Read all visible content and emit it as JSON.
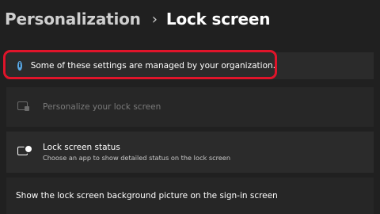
{
  "breadcrumb": {
    "parent": "Personalization",
    "separator": "›",
    "current": "Lock screen"
  },
  "info_bar": {
    "icon": "info-icon",
    "text": "Some of these settings are managed by your organization."
  },
  "settings": {
    "personalize": {
      "icon": "lock-screen-icon",
      "label": "Personalize your lock screen",
      "disabled": true
    },
    "status": {
      "icon": "lock-screen-status-icon",
      "title": "Lock screen status",
      "subtitle": "Choose an app to show detailed status on the lock screen"
    },
    "background": {
      "title": "Show the lock screen background picture on the sign-in screen"
    }
  },
  "colors": {
    "background": "#202020",
    "card": "#2b2b2b",
    "highlight": "#e0142a",
    "info_accent": "#5aa9e6"
  }
}
